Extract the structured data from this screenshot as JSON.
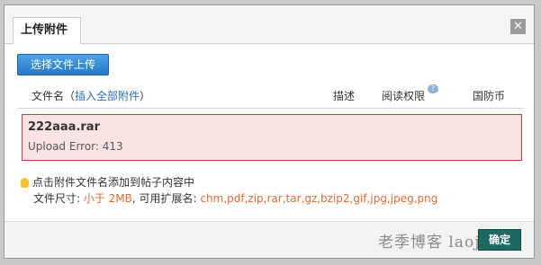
{
  "tab": {
    "label": "上传附件"
  },
  "toolbar": {
    "upload_label": "选择文件上传"
  },
  "table_header": {
    "name": "文件名",
    "insert_open": "（",
    "insert_all": "插入全部附件",
    "insert_close": "）",
    "desc": "描述",
    "perm": "阅读权限",
    "coin": "国防币"
  },
  "upload_error": {
    "filename": "222aaa.rar",
    "message": "Upload Error: 413"
  },
  "tips": {
    "line1": "点击附件文件名添加到帖子内容中",
    "size_prefix": "文件尺寸:",
    "size_value": "小于 2MB",
    "ext_prefix": ", 可用扩展名:",
    "ext_value": "chm,pdf,zip,rar,tar,gz,bzip2,gif,jpg,jpeg,png"
  },
  "footer": {
    "watermark": "老季博客 laoji.org",
    "ok_label": "确定"
  },
  "colors": {
    "accent": "#2279c9",
    "error_bg": "#fde4e4",
    "error_border": "#c23b3b",
    "ok": "#1e6a62",
    "orange": "#e06b34"
  }
}
